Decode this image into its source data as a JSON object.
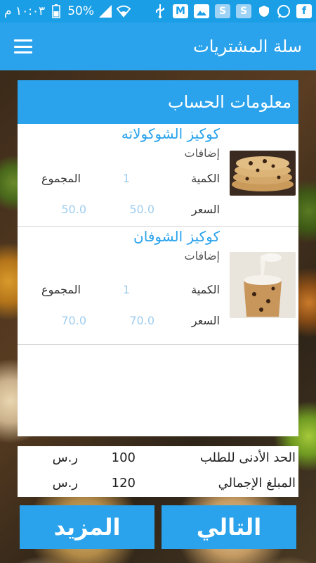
{
  "statusbar": {
    "time": "١٠:٠٣ م",
    "battery": "50%"
  },
  "appbar": {
    "title": "سلة المشتريات"
  },
  "card": {
    "header": "معلومات الحساب",
    "labels": {
      "quantity": "الكمية",
      "total": "المجموع",
      "price": "السعر"
    },
    "items": [
      {
        "name": "كوكيز الشوكولاته",
        "extras": "إضافات",
        "quantity": "1",
        "price": "50.0",
        "total": "50.0"
      },
      {
        "name": "كوكيز الشوفان",
        "extras": "إضافات",
        "quantity": "1",
        "price": "70.0",
        "total": "70.0"
      }
    ]
  },
  "totals": {
    "min_order_label": "الحد الأدنى للطلب",
    "min_order_value": "100",
    "min_order_currency": "ر.س",
    "grand_total_label": "المبلغ الإجمالي",
    "grand_total_value": "120",
    "grand_total_currency": "ر.س"
  },
  "buttons": {
    "next": "التالي",
    "more": "المزيد"
  },
  "colors": {
    "primary": "#2aa3ec",
    "statusbar": "#1a9ee6",
    "value_text": "#9fcdef"
  }
}
